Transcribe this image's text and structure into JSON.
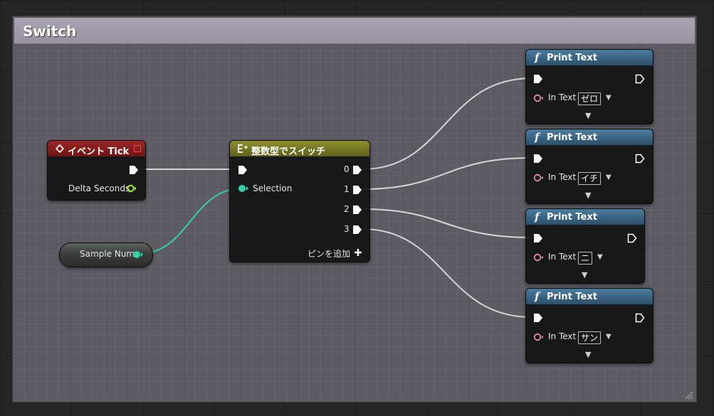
{
  "comment": {
    "title": "Switch"
  },
  "event_node": {
    "title": "イベント Tick",
    "output_label": "Delta Seconds",
    "header_color": "#7f1a1a"
  },
  "switch_node": {
    "title": "整数型でスイッチ",
    "input_label": "Selection",
    "outputs": [
      "0",
      "1",
      "2",
      "3"
    ],
    "add_pin_label": "ピンを追加",
    "header_color": "#7a7d27"
  },
  "variable_node": {
    "label": "Sample Num"
  },
  "print_nodes": [
    {
      "title": "Print Text",
      "in_text_label": "In Text",
      "value": "ゼロ"
    },
    {
      "title": "Print Text",
      "in_text_label": "In Text",
      "value": "イチ"
    },
    {
      "title": "Print Text",
      "in_text_label": "In Text",
      "value": "ニ"
    },
    {
      "title": "Print Text",
      "in_text_label": "In Text",
      "value": "サン"
    }
  ],
  "colors": {
    "exec": "#ffffff",
    "integer": "#34d0ab",
    "float": "#9ef03b",
    "text": "#e08da2",
    "function_header": "#3a6a8c"
  }
}
